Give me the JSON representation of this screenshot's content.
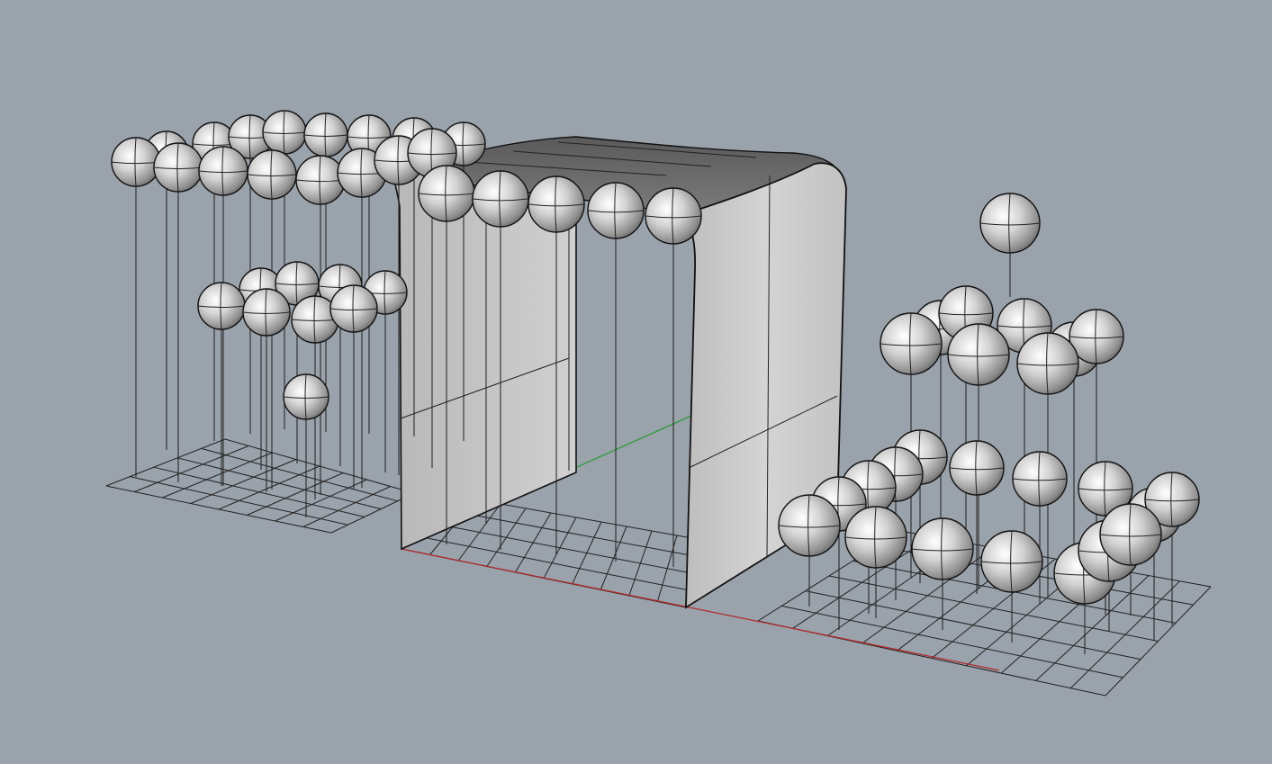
{
  "viewport": {
    "view": "perspective",
    "background_color": "#9aa2ab",
    "grid_color": "#1e1e1e",
    "x_axis_color": "#b02a2a",
    "y_axis_color": "#2f9a3a",
    "sphere_color": "#d6d6d6",
    "surface_color": "#c6c6c6",
    "roof_color": "#6a6a6a"
  },
  "scene": {
    "objects": [
      {
        "name": "sphere-grid-left",
        "kind": "spheres on stems",
        "rows": 4
      },
      {
        "name": "draped-surface",
        "kind": "surface"
      },
      {
        "name": "sphere-grid-right",
        "kind": "spheres on stems",
        "rows": 3
      }
    ]
  }
}
